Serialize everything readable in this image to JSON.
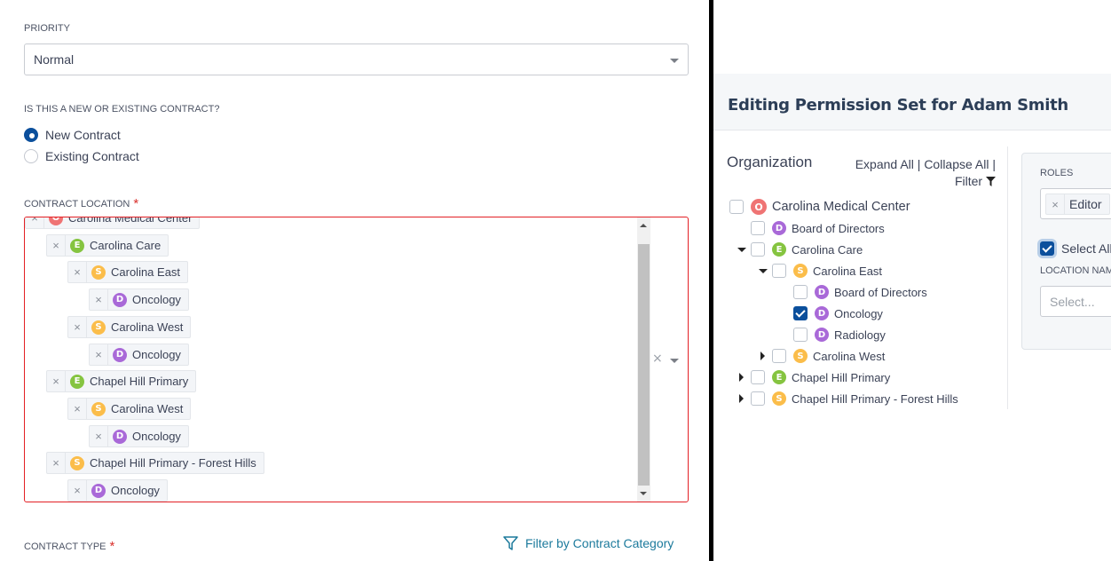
{
  "form": {
    "priority": {
      "label": "PRIORITY",
      "value": "Normal"
    },
    "contract_status": {
      "label": "IS THIS A NEW OR EXISTING CONTRACT?",
      "options": [
        {
          "label": "New Contract",
          "selected": true
        },
        {
          "label": "Existing Contract",
          "selected": false
        }
      ]
    },
    "contract_location": {
      "label": "CONTRACT LOCATION",
      "required_mark": "*",
      "clear_icon": "×",
      "selected": [
        {
          "badge": "O",
          "name": "Carolina Medical Center",
          "level": 0
        },
        {
          "badge": "E",
          "name": "Carolina Care",
          "level": 1
        },
        {
          "badge": "S",
          "name": "Carolina East",
          "level": 2
        },
        {
          "badge": "D",
          "name": "Oncology",
          "level": 3
        },
        {
          "badge": "S",
          "name": "Carolina West",
          "level": 2
        },
        {
          "badge": "D",
          "name": "Oncology",
          "level": 3
        },
        {
          "badge": "E",
          "name": "Chapel Hill Primary",
          "level": 1
        },
        {
          "badge": "S",
          "name": "Carolina West",
          "level": 2
        },
        {
          "badge": "D",
          "name": "Oncology",
          "level": 3
        },
        {
          "badge": "S",
          "name": "Chapel Hill Primary - Forest Hills",
          "level": 1
        },
        {
          "badge": "D",
          "name": "Oncology",
          "level": 2
        }
      ],
      "remove_icon": "×"
    },
    "contract_type": {
      "label": "CONTRACT TYPE",
      "required_mark": "*",
      "filter_link": "Filter by Contract Category"
    }
  },
  "permission_modal": {
    "title": "Editing Permission Set for Adam Smith",
    "organization": {
      "title": "Organization",
      "expand_all": "Expand All",
      "collapse_all": "Collapse All",
      "separator": "|",
      "filter": "Filter",
      "tree": [
        {
          "badge": "O",
          "name": "Carolina Medical Center",
          "depth": 0,
          "toggle": "none",
          "checked": false
        },
        {
          "badge": "D",
          "name": "Board of Directors",
          "depth": 1,
          "toggle": "none",
          "checked": false
        },
        {
          "badge": "E",
          "name": "Carolina Care",
          "depth": 1,
          "toggle": "expanded",
          "checked": false
        },
        {
          "badge": "S",
          "name": "Carolina East",
          "depth": 2,
          "toggle": "expanded",
          "checked": false
        },
        {
          "badge": "D",
          "name": "Board of Directors",
          "depth": 3,
          "toggle": "none",
          "checked": false
        },
        {
          "badge": "D",
          "name": "Oncology",
          "depth": 3,
          "toggle": "none",
          "checked": true
        },
        {
          "badge": "D",
          "name": "Radiology",
          "depth": 3,
          "toggle": "none",
          "checked": false
        },
        {
          "badge": "S",
          "name": "Carolina West",
          "depth": 2,
          "toggle": "collapsed",
          "checked": false
        },
        {
          "badge": "E",
          "name": "Chapel Hill Primary",
          "depth": 1,
          "toggle": "collapsed",
          "checked": false
        },
        {
          "badge": "S",
          "name": "Chapel Hill Primary - Forest Hills",
          "depth": 1,
          "toggle": "collapsed",
          "checked": false
        }
      ]
    },
    "roles": {
      "label": "ROLES",
      "selected": [
        "Editor"
      ],
      "select_all_label": "Select All",
      "select_all_checked": true,
      "location_name_label": "LOCATION NAME",
      "location_name_placeholder": "Select..."
    }
  },
  "badge_colors": {
    "O": "#ef7474",
    "E": "#85c440",
    "S": "#fbbd4a",
    "D": "#a969d8"
  },
  "accent_color": "#0b4f9c",
  "error_color": "#e32025",
  "link_color": "#1c7a9c"
}
